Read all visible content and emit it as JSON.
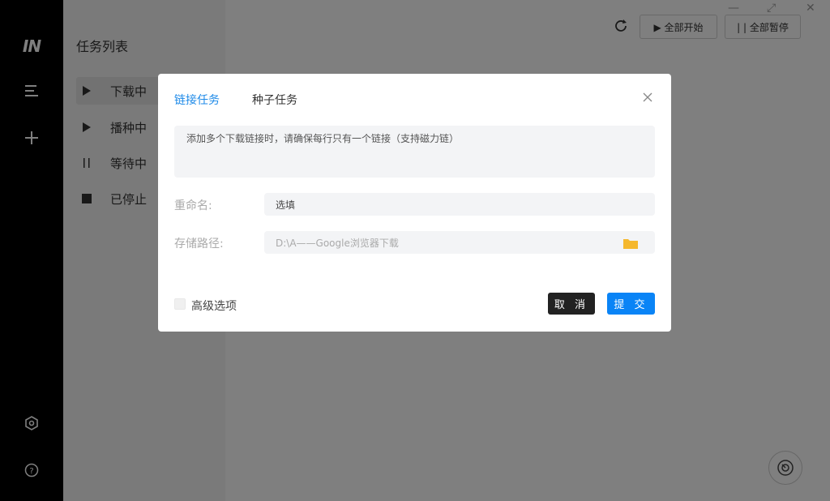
{
  "app": {
    "logo": "IN"
  },
  "sidebar": {
    "title": "任务列表",
    "items": [
      {
        "label": "下载中",
        "icon": "play-icon"
      },
      {
        "label": "播种中",
        "icon": "play-icon"
      },
      {
        "label": "等待中",
        "icon": "pause-icon"
      },
      {
        "label": "已停止",
        "icon": "stop-icon"
      }
    ]
  },
  "toolbar": {
    "start_all": "▶ 全部开始",
    "pause_all": "| | 全部暂停"
  },
  "dialog": {
    "tabs": [
      "链接任务",
      "种子任务"
    ],
    "active_tab": "链接任务",
    "links_placeholder": "添加多个下载链接时，请确保每行只有一个链接（支持磁力链）",
    "rename_label": "重命名:",
    "rename_placeholder": "选填",
    "path_label": "存储路径:",
    "path_value": "D:\\A——Google浏览器下载",
    "advanced_label": "高级选项",
    "cancel_label": "取 消",
    "submit_label": "提 交"
  },
  "colors": {
    "accent": "#0a84f6",
    "tab_active": "#1e8ae8",
    "folder": "#f5b82e"
  }
}
